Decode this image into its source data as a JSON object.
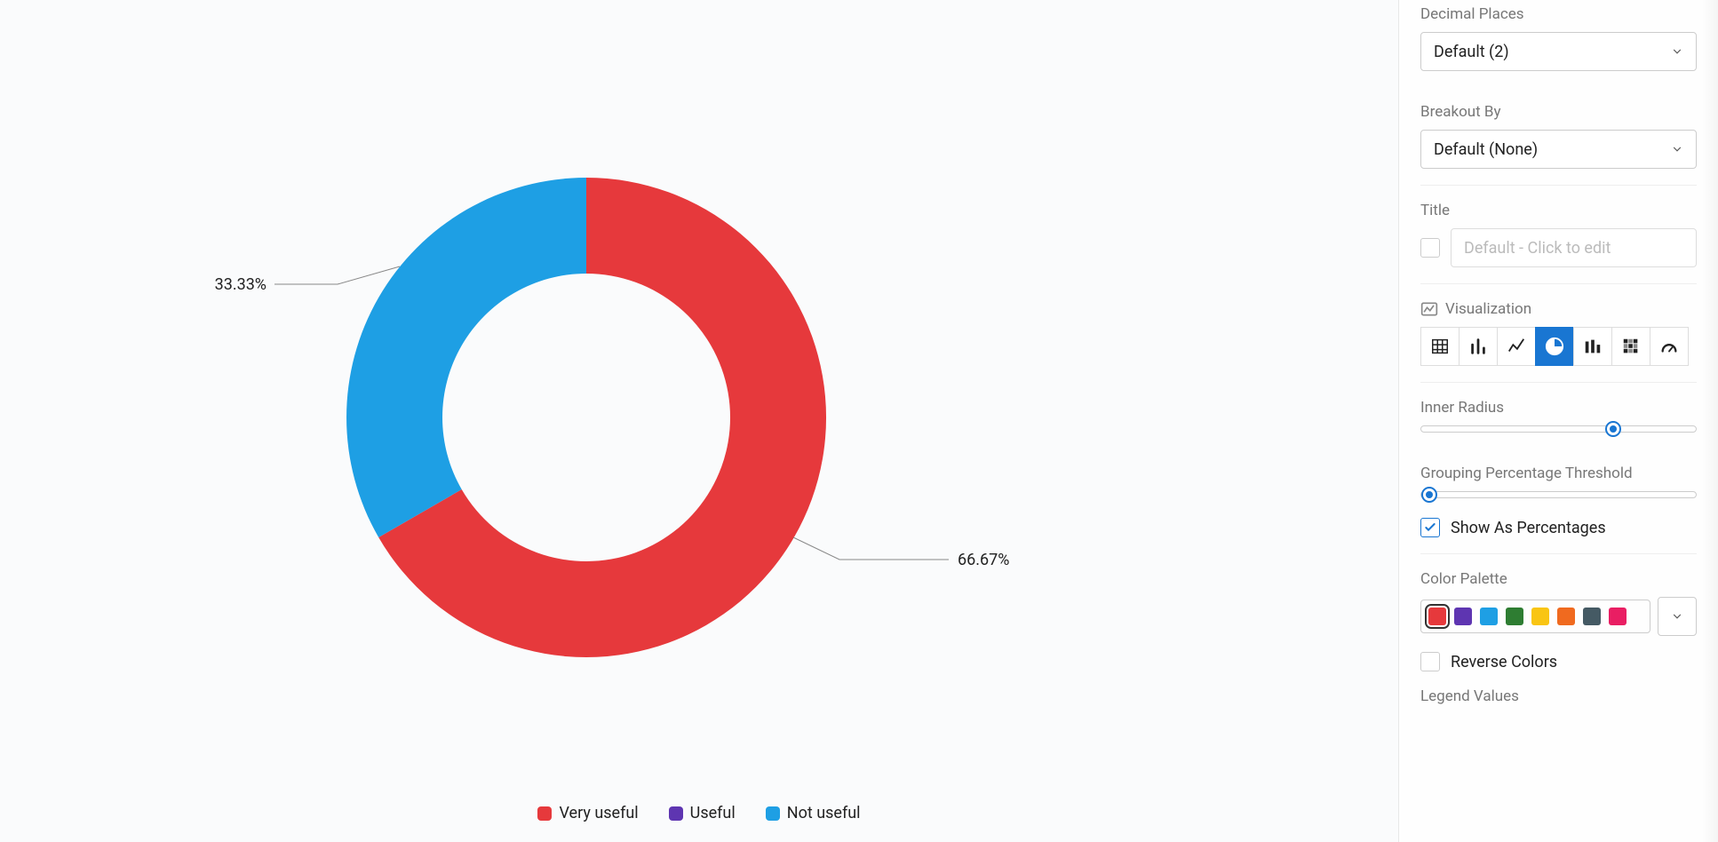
{
  "chart_data": {
    "type": "pie",
    "inner_radius_pct": 60,
    "series": [
      {
        "name": "Very useful",
        "value": 66.67,
        "color": "#E6393C"
      },
      {
        "name": "Useful",
        "value": 0,
        "color": "#5E35B1"
      },
      {
        "name": "Not useful",
        "value": 33.33,
        "color": "#1E9FE4"
      }
    ],
    "labels": {
      "left": "33.33%",
      "right": "66.67%"
    },
    "legend": [
      {
        "label": "Very useful",
        "color": "#E6393C"
      },
      {
        "label": "Useful",
        "color": "#5E35B1"
      },
      {
        "label": "Not useful",
        "color": "#1E9FE4"
      }
    ]
  },
  "sidebar": {
    "decimal_places": {
      "label": "Decimal Places",
      "value": "Default (2)"
    },
    "breakout_by": {
      "label": "Breakout By",
      "value": "Default (None)"
    },
    "title_section": {
      "label": "Title",
      "checked": false,
      "placeholder": "Default - Click to edit"
    },
    "visualization": {
      "label": "Visualization",
      "selected": "pie",
      "options": [
        "table",
        "bar",
        "line",
        "pie",
        "stacked",
        "heatmap",
        "gauge"
      ]
    },
    "inner_radius": {
      "label": "Inner Radius",
      "value_pct": 70
    },
    "grouping_threshold": {
      "label": "Grouping Percentage Threshold",
      "value_pct": 0
    },
    "show_as_percentages": {
      "label": "Show As Percentages",
      "checked": true
    },
    "color_palette": {
      "label": "Color Palette",
      "colors": [
        "#E6393C",
        "#5E35B1",
        "#1E9FE4",
        "#2E7D32",
        "#F9C513",
        "#F06A1F",
        "#455A64",
        "#E91E63"
      ],
      "selected_index": 0
    },
    "reverse_colors": {
      "label": "Reverse Colors",
      "checked": false
    },
    "legend_values": {
      "label": "Legend Values"
    }
  }
}
